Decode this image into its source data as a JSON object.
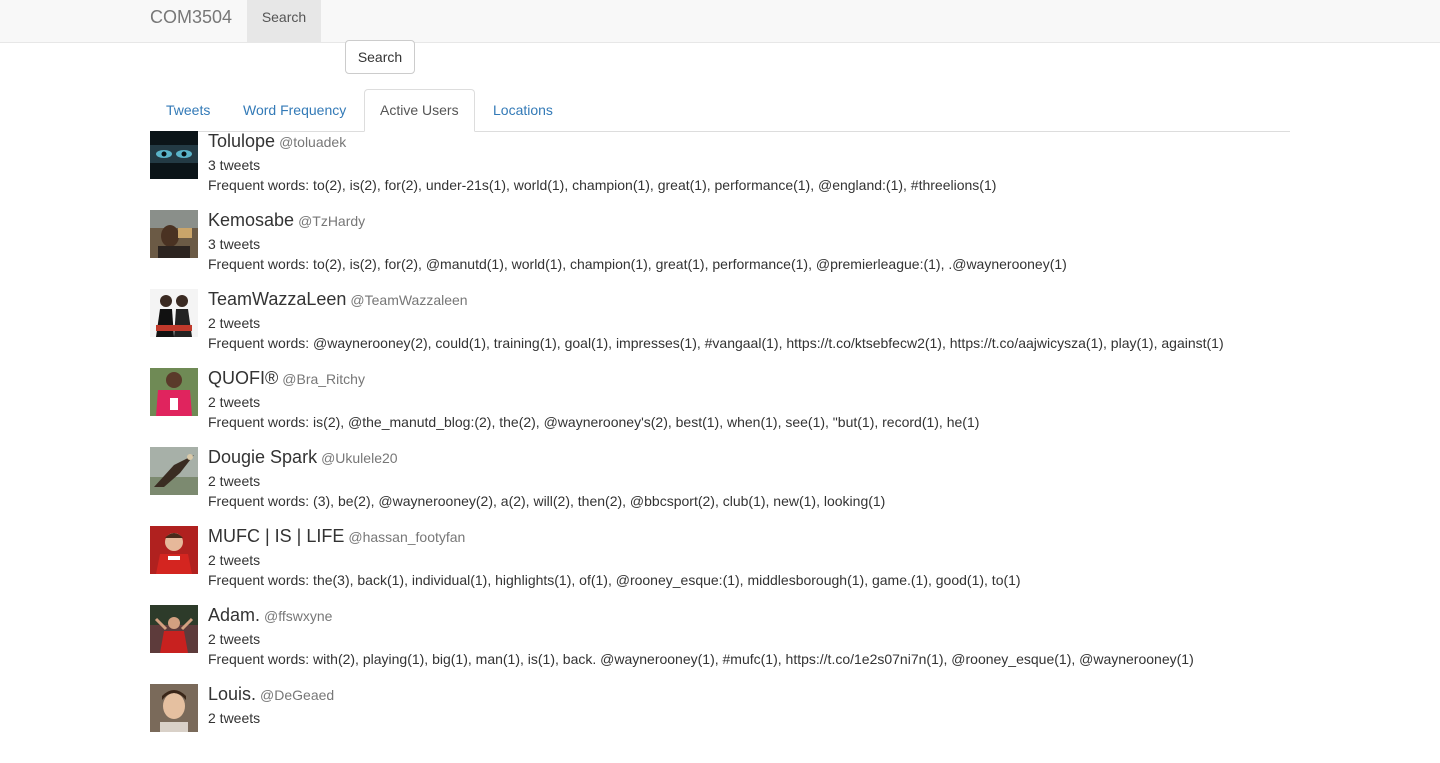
{
  "navbar": {
    "brand": "COM3504",
    "search_label": "Search"
  },
  "search_button_label": "Search",
  "tabs": [
    {
      "label": "Tweets"
    },
    {
      "label": "Word Frequency"
    },
    {
      "label": "Active Users",
      "active": true
    },
    {
      "label": "Locations"
    }
  ],
  "users": [
    {
      "name": "Tolulope",
      "handle": "@toluadek",
      "tweets": "3 tweets",
      "words": "Frequent words: to(2), is(2), for(2), under-21s(1), world(1), champion(1), great(1), performance(1), @england:(1), #threelions(1)"
    },
    {
      "name": "Kemosabe",
      "handle": "@TzHardy",
      "tweets": "3 tweets",
      "words": "Frequent words: to(2), is(2), for(2), @manutd(1), world(1), champion(1), great(1), performance(1), @premierleague:(1), .@waynerooney(1)"
    },
    {
      "name": "TeamWazzaLeen",
      "handle": "@TeamWazzaleen",
      "tweets": "2 tweets",
      "words": "Frequent words: @waynerooney(2), could(1), training(1), goal(1), impresses(1), #vangaal(1), https://t.co/ktsebfecw2(1), https://t.co/aajwicysza(1), play(1), against(1)"
    },
    {
      "name": "QUOFI®",
      "handle": "@Bra_Ritchy",
      "tweets": "2 tweets",
      "words": "Frequent words: is(2), @the_manutd_blog:(2), the(2), @waynerooney's(2), best(1), when(1), see(1), \"but(1), record(1), he(1)"
    },
    {
      "name": "Dougie Spark",
      "handle": "@Ukulele20",
      "tweets": "2 tweets",
      "words": "Frequent words: (3), be(2), @waynerooney(2), a(2), will(2), then(2), @bbcsport(2), club(1), new(1), looking(1)"
    },
    {
      "name": "MUFC | IS | LIFE",
      "handle": "@hassan_footyfan",
      "tweets": "2 tweets",
      "words": "Frequent words: the(3), back(1), individual(1), highlights(1), of(1), @rooney_esque:(1), middlesborough(1), game.(1), good(1), to(1)"
    },
    {
      "name": "Adam.",
      "handle": "@ffswxyne",
      "tweets": "2 tweets",
      "words": "Frequent words: with(2), playing(1), big(1), man(1), is(1), back. @waynerooney(1), #mufc(1), https://t.co/1e2s07ni7n(1), @rooney_esque(1), @waynerooney(1)"
    },
    {
      "name": "Louis.",
      "handle": "@DeGeaed",
      "tweets": "2 tweets",
      "words": ""
    }
  ]
}
